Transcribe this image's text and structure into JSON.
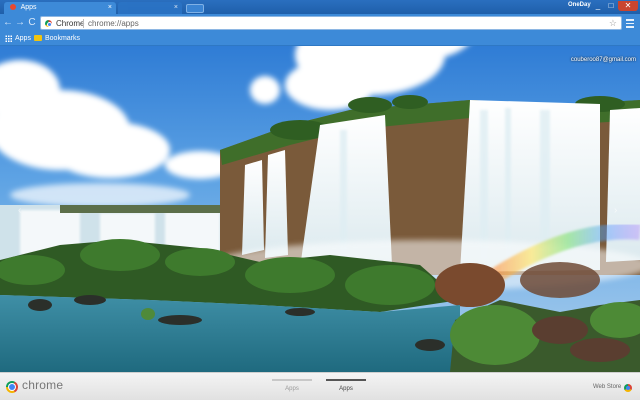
{
  "window": {
    "user_badge": "OneDay",
    "min_icon": "_",
    "max_icon": "□",
    "close_icon": "✕"
  },
  "tabs": [
    {
      "title": "Apps",
      "close": "×",
      "state": "active"
    },
    {
      "title": "",
      "close": "×",
      "state": "inactive"
    }
  ],
  "toolbar": {
    "back": "←",
    "forward": "→",
    "reload": "C",
    "scheme_label": "Chrome",
    "url": "chrome://apps",
    "star": "☆"
  },
  "bookmarks": {
    "apps_label": "Apps",
    "bookmarks_label": "Bookmarks"
  },
  "profile": {
    "email": "couberoo87@gmail.com"
  },
  "launcher": {
    "prev": "‹",
    "next": "›"
  },
  "shelf": {
    "brand": "chrome",
    "page_tabs": [
      {
        "label": "Apps",
        "active": false
      },
      {
        "label": "Apps",
        "active": true
      }
    ],
    "web_store": "Web Store"
  },
  "colors": {
    "chrome_frame": "#3d8ad8",
    "close_button": "#c9452f",
    "shelf": "#e9e9e9"
  }
}
